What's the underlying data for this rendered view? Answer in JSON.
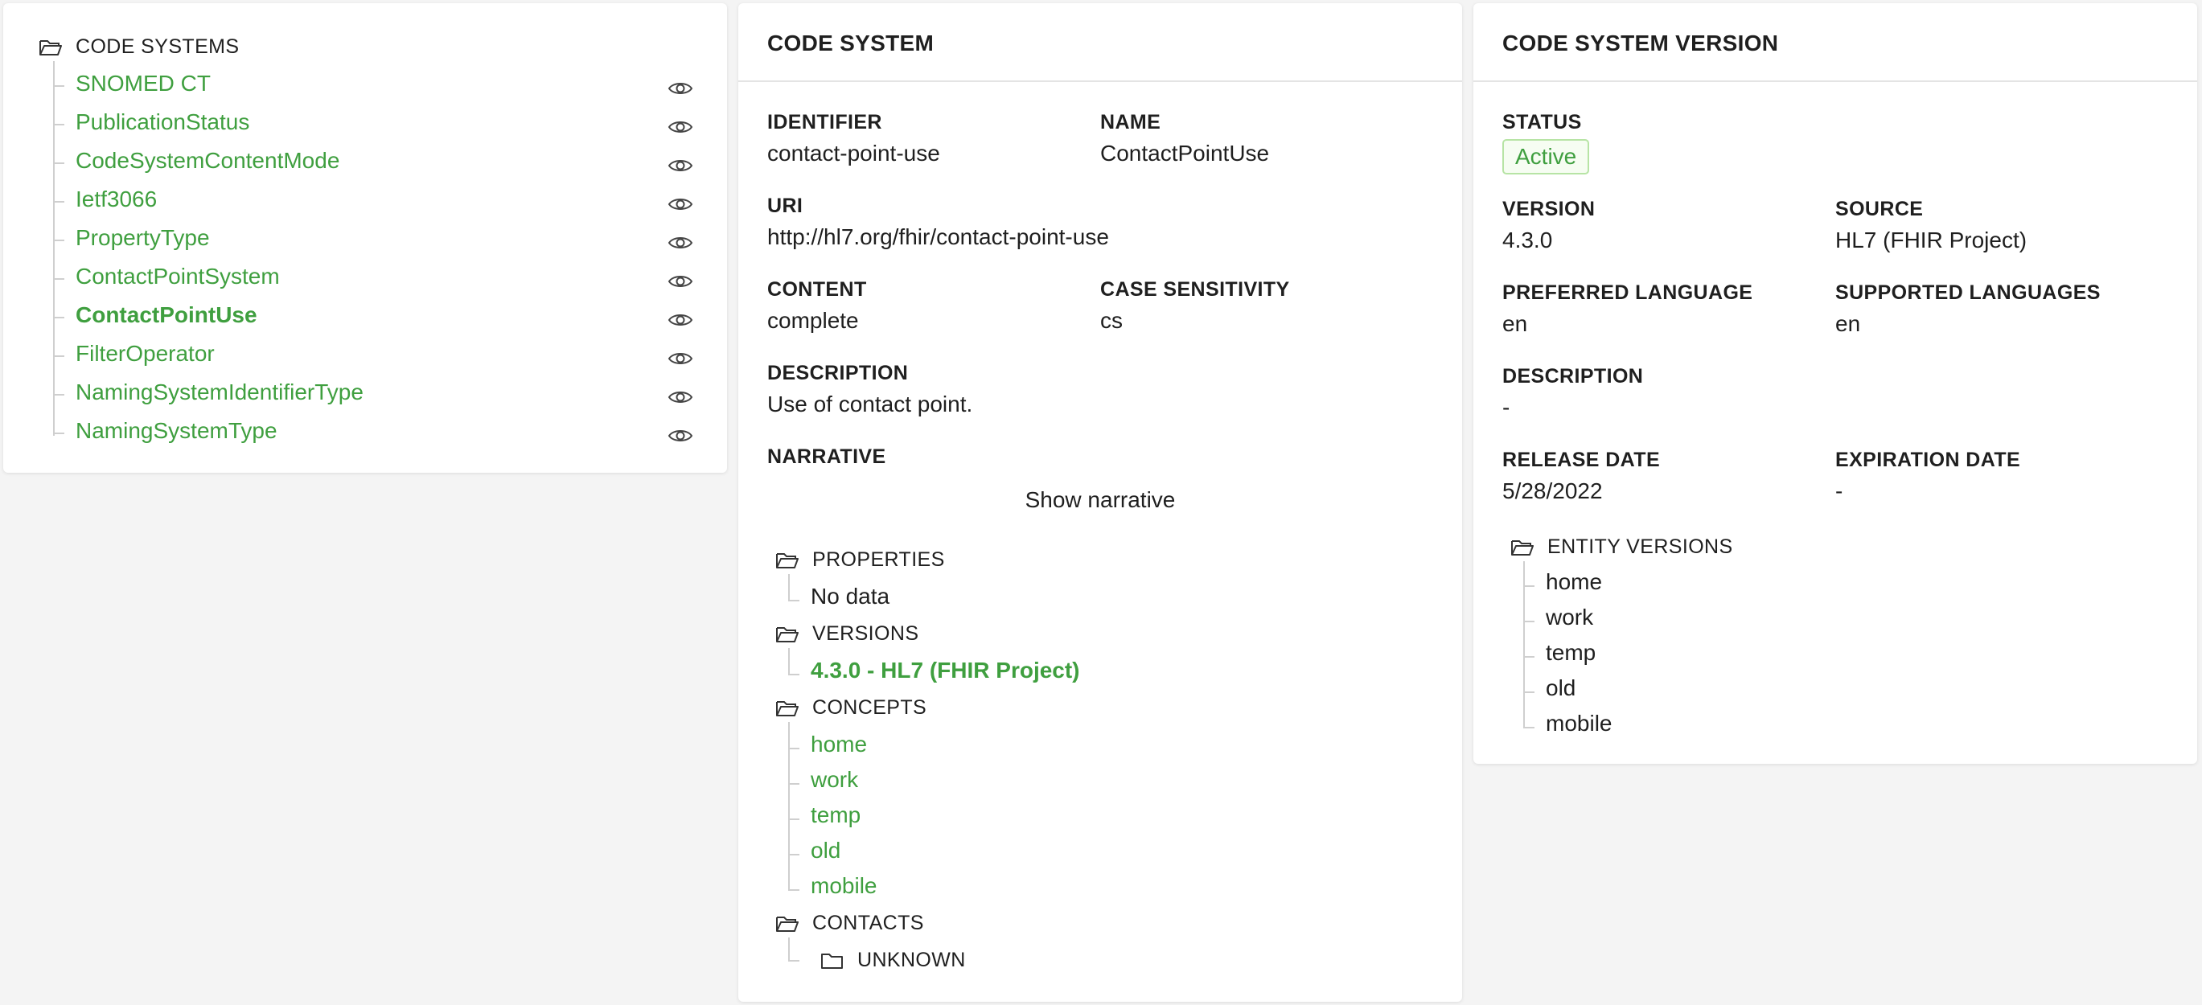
{
  "tree": {
    "title": "CODE SYSTEMS",
    "items": [
      {
        "label": "SNOMED CT",
        "selected": false
      },
      {
        "label": "PublicationStatus",
        "selected": false
      },
      {
        "label": "CodeSystemContentMode",
        "selected": false
      },
      {
        "label": "Ietf3066",
        "selected": false
      },
      {
        "label": "PropertyType",
        "selected": false
      },
      {
        "label": "ContactPointSystem",
        "selected": false
      },
      {
        "label": "ContactPointUse",
        "selected": true
      },
      {
        "label": "FilterOperator",
        "selected": false
      },
      {
        "label": "NamingSystemIdentifierType",
        "selected": false
      },
      {
        "label": "NamingSystemType",
        "selected": false
      }
    ]
  },
  "code_system": {
    "title": "CODE SYSTEM",
    "identifier_label": "IDENTIFIER",
    "identifier": "contact-point-use",
    "name_label": "NAME",
    "name": "ContactPointUse",
    "uri_label": "URI",
    "uri": "http://hl7.org/fhir/contact-point-use",
    "content_label": "CONTENT",
    "content": "complete",
    "case_label": "CASE SENSITIVITY",
    "case": "cs",
    "description_label": "DESCRIPTION",
    "description": "Use of contact point.",
    "narrative_label": "NARRATIVE",
    "narrative_button": "Show narrative",
    "properties_label": "PROPERTIES",
    "properties_empty": "No data",
    "versions_label": "VERSIONS",
    "versions": [
      "4.3.0 - HL7 (FHIR Project)"
    ],
    "concepts_label": "CONCEPTS",
    "concepts": [
      "home",
      "work",
      "temp",
      "old",
      "mobile"
    ],
    "contacts_label": "CONTACTS",
    "contacts": [
      "UNKNOWN"
    ]
  },
  "code_system_version": {
    "title": "CODE SYSTEM VERSION",
    "status_label": "STATUS",
    "status": "Active",
    "version_label": "VERSION",
    "version": "4.3.0",
    "source_label": "SOURCE",
    "source": "HL7 (FHIR Project)",
    "preferred_language_label": "PREFERRED LANGUAGE",
    "preferred_language": "en",
    "supported_languages_label": "SUPPORTED LANGUAGES",
    "supported_languages": "en",
    "description_label": "DESCRIPTION",
    "description": "-",
    "release_date_label": "RELEASE DATE",
    "release_date": "5/28/2022",
    "expiration_date_label": "EXPIRATION DATE",
    "expiration_date": "-",
    "entity_versions_label": "ENTITY VERSIONS",
    "entity_versions": [
      "home",
      "work",
      "temp",
      "old",
      "mobile"
    ]
  },
  "colors": {
    "accent_green": "#3f9f3f",
    "tag_border": "#b7e4a5",
    "background": "#f4f4f4"
  },
  "icons": {
    "folder": "folder-open-icon",
    "eye": "eye-icon"
  }
}
